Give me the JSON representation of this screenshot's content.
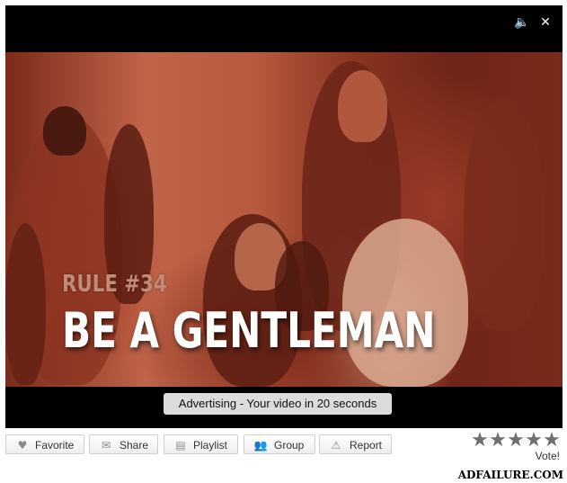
{
  "player": {
    "volume_icon": "volume-icon",
    "close_icon": "close-icon",
    "rule_number": "RULE #34",
    "rule_title": "BE A GENTLEMAN",
    "ad_banner": "Advertising - Your video in 20 seconds"
  },
  "actions": [
    {
      "label": "Favorite",
      "icon": "heart-icon"
    },
    {
      "label": "Share",
      "icon": "envelope-icon"
    },
    {
      "label": "Playlist",
      "icon": "playlist-icon"
    },
    {
      "label": "Group",
      "icon": "group-icon"
    },
    {
      "label": "Report",
      "icon": "warning-icon"
    }
  ],
  "rating": {
    "stars": 5,
    "vote_label": "Vote!"
  },
  "watermark": "ADFAILURE.COM",
  "colors": {
    "player_bg": "#000000",
    "video_tint": "#b2553c",
    "banner_bg": "#dcdcdc",
    "star": "#6f6f6f"
  }
}
